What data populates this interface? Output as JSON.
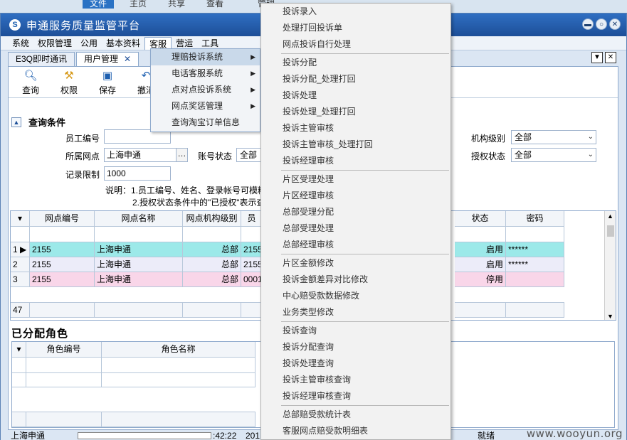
{
  "background": {
    "tabs": [
      "文件",
      "主页",
      "共享",
      "查看",
      "管理"
    ]
  },
  "window": {
    "title": "申通服务质量监管平台",
    "logo": "S",
    "controls": [
      "minimize",
      "maximize",
      "close"
    ]
  },
  "menubar": {
    "items": [
      "系统",
      "权限管理",
      "公用",
      "基本资料",
      "客服",
      "营运",
      "工具"
    ]
  },
  "tabs": [
    {
      "label": "E3Q即时通讯"
    },
    {
      "label": "用户管理",
      "close": "✕"
    }
  ],
  "toolbar": {
    "query": "查询",
    "permission": "权限",
    "save": "保存",
    "undo": "撤消"
  },
  "query": {
    "title": "查询条件",
    "employee_id_label": "员工编号",
    "employee_id_value": "",
    "branch_label": "所属网点",
    "branch_value": "上海申通",
    "account_status_label": "账号状态",
    "account_status_value": "全部",
    "record_limit_label": "记录限制",
    "record_limit_value": "1000",
    "org_level_label": "机构级别",
    "org_level_value": "全部",
    "auth_status_label": "授权状态",
    "auth_status_value": "全部",
    "note_line1": "说明：1.员工编号、姓名、登录帐号可模糊",
    "note_line2": "2.授权状态条件中的\"已授权\"表示查"
  },
  "grid1": {
    "headers": [
      "网点编号",
      "网点名称",
      "网点机构级别",
      "员",
      "状态",
      "密码"
    ],
    "rows": [
      {
        "num": "1",
        "code": "2155",
        "name": "上海申通",
        "level": "总部",
        "emp": "2155",
        "status": "启用",
        "pwd": "******"
      },
      {
        "num": "2",
        "code": "2155",
        "name": "上海申通",
        "level": "总部",
        "emp": "2155",
        "status": "启用",
        "pwd": "******"
      },
      {
        "num": "3",
        "code": "2155",
        "name": "上海申通",
        "level": "总部",
        "emp": "0001",
        "status": "停用",
        "pwd": ""
      }
    ],
    "count": "47"
  },
  "roles": {
    "title": "已分配角色",
    "headers": [
      "角色编号",
      "角色名称"
    ]
  },
  "status": {
    "branch": "上海申通",
    "time": ":42:22",
    "year": "201",
    "ready": "就绪"
  },
  "menu1": {
    "items": [
      {
        "label": "理赔投诉系统",
        "sub": "▶"
      },
      {
        "label": "电话客服系统",
        "sub": "▶"
      },
      {
        "label": "点对点投诉系统",
        "sub": "▶"
      },
      {
        "label": "网点奖惩管理",
        "sub": "▶"
      },
      {
        "label": "查询淘宝订单信息",
        "sub": ""
      }
    ]
  },
  "menu2": {
    "groups": [
      [
        "投诉录入",
        "处理打回投诉单",
        "网点投诉自行处理"
      ],
      [
        "投诉分配",
        "投诉分配_处理打回",
        "投诉处理",
        "投诉处理_处理打回",
        "投诉主管审核",
        "投诉主管审核_处理打回",
        "投诉经理审核"
      ],
      [
        "片区受理处理",
        "片区经理审核",
        "总部受理分配",
        "总部受理处理",
        "总部经理审核"
      ],
      [
        "片区金额修改",
        "投诉金额差异对比修改",
        "中心赔受款数据修改",
        "业务类型修改"
      ],
      [
        "投诉查询",
        "投诉分配查询",
        "投诉处理查询",
        "投诉主管审核查询",
        "投诉经理审核查询"
      ],
      [
        "总部赔受款统计表",
        "客服网点赔受款明细表"
      ]
    ]
  },
  "watermark": "www.wooyun.org"
}
